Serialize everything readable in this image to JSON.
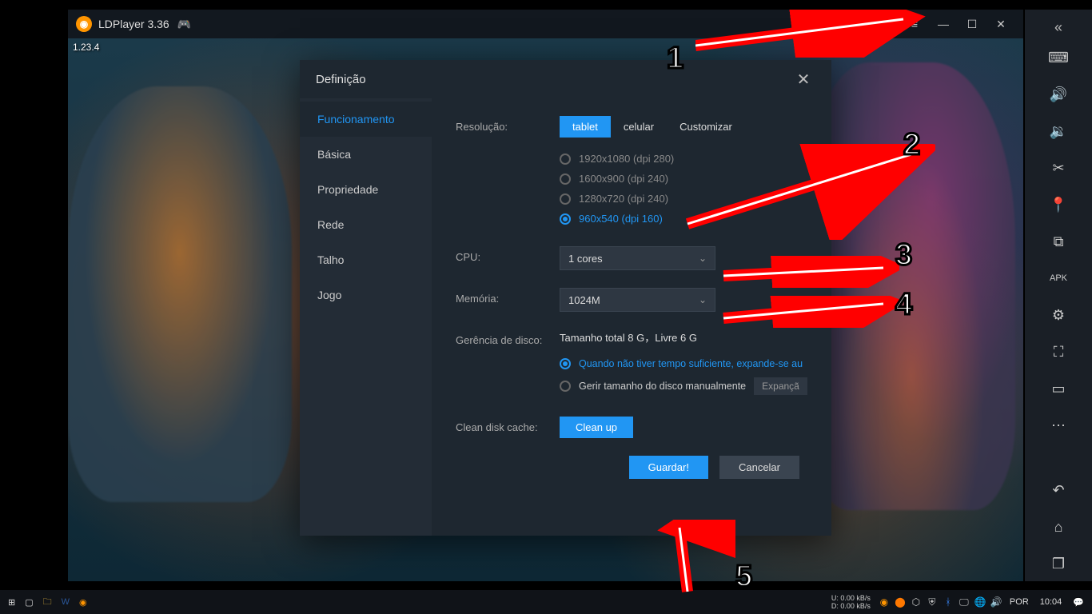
{
  "app": {
    "title": "LDPlayer 3.36",
    "version_overlay": "1.23.4"
  },
  "titlebar_icons": {
    "hamburger": "≡",
    "minimize": "—",
    "maximize": "☐",
    "close": "✕"
  },
  "right_toolbar": {
    "collapse": "«",
    "icons": [
      "keyboard-icon",
      "volume-up-icon",
      "volume-down-icon",
      "scissors-icon",
      "location-icon",
      "add-window-icon",
      "apk-icon",
      "settings-icon",
      "fullscreen-icon",
      "screenshot-icon",
      "more-icon"
    ],
    "bottom_icons": [
      "back-icon",
      "home-icon",
      "recents-icon"
    ]
  },
  "dialog": {
    "title": "Definição",
    "tabs": [
      "Funcionamento",
      "Básica",
      "Propriedade",
      "Rede",
      "Talho",
      "Jogo"
    ],
    "active_tab": 0,
    "resolution": {
      "label": "Resolução:",
      "modes": [
        "tablet",
        "celular",
        "Customizar"
      ],
      "active_mode": 0,
      "options": [
        "1920x1080  (dpi 280)",
        "1600x900  (dpi 240)",
        "1280x720  (dpi 240)",
        "960x540  (dpi 160)"
      ],
      "selected": 3
    },
    "cpu": {
      "label": "CPU:",
      "value": "1 cores"
    },
    "memory": {
      "label": "Memória:",
      "value": "1024M"
    },
    "disk": {
      "label": "Gerência de disco:",
      "info": "Tamanho total 8 G，Livre 6 G",
      "opt_auto": "Quando não tiver tempo suficiente, expande-se au",
      "opt_manual": "Gerir tamanho do disco manualmente",
      "expand_btn": "Expançã",
      "selected": 0
    },
    "clean": {
      "label": "Clean disk cache:",
      "button": "Clean up"
    },
    "footer": {
      "save": "Guardar!",
      "cancel": "Cancelar"
    }
  },
  "annotations": {
    "steps": [
      "1",
      "2",
      "3",
      "4",
      "5"
    ]
  },
  "taskbar": {
    "net": {
      "u_label": "U:",
      "d_label": "D:",
      "u": "0.00 kB/s",
      "d": "0.00 kB/s"
    },
    "lang": "POR",
    "time": "10:04"
  }
}
